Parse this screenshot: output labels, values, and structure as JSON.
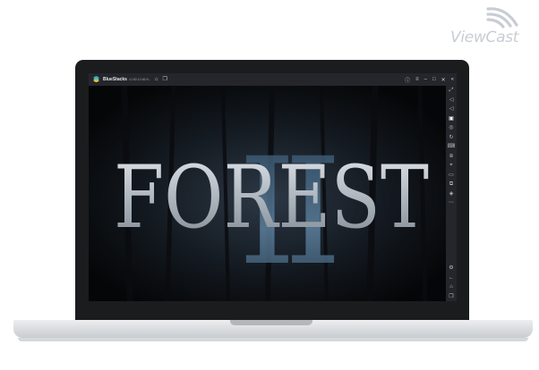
{
  "watermark": {
    "brand": "ViewCast",
    "icon": "wifi-arcs-icon"
  },
  "emulator": {
    "app_name": "BlueStacks",
    "version": "4.150.10.66 N..",
    "titlebar_icons": [
      "home-icon",
      "multi-instance-icon"
    ],
    "window_controls": [
      "help-icon",
      "menu-icon",
      "minimize-icon",
      "maximize-icon",
      "close-icon",
      "collapse-sidebar-icon"
    ]
  },
  "game": {
    "title": "FOREST",
    "numeral": "II",
    "colors": {
      "title": "#b9c0c8",
      "numeral": "#4c6d87",
      "background": "#070809"
    }
  },
  "sidebar": {
    "tools": [
      "fullscreen-icon",
      "volume-up-icon",
      "volume-down-icon",
      "media-icon",
      "screenshot-icon",
      "rotate-icon",
      "keyboard-icon",
      "shake-icon",
      "location-icon",
      "folder-icon",
      "copy-icon",
      "layers-icon",
      "more-icon"
    ],
    "bottom": [
      "settings-icon",
      "back-icon",
      "home-icon",
      "recent-apps-icon"
    ]
  }
}
